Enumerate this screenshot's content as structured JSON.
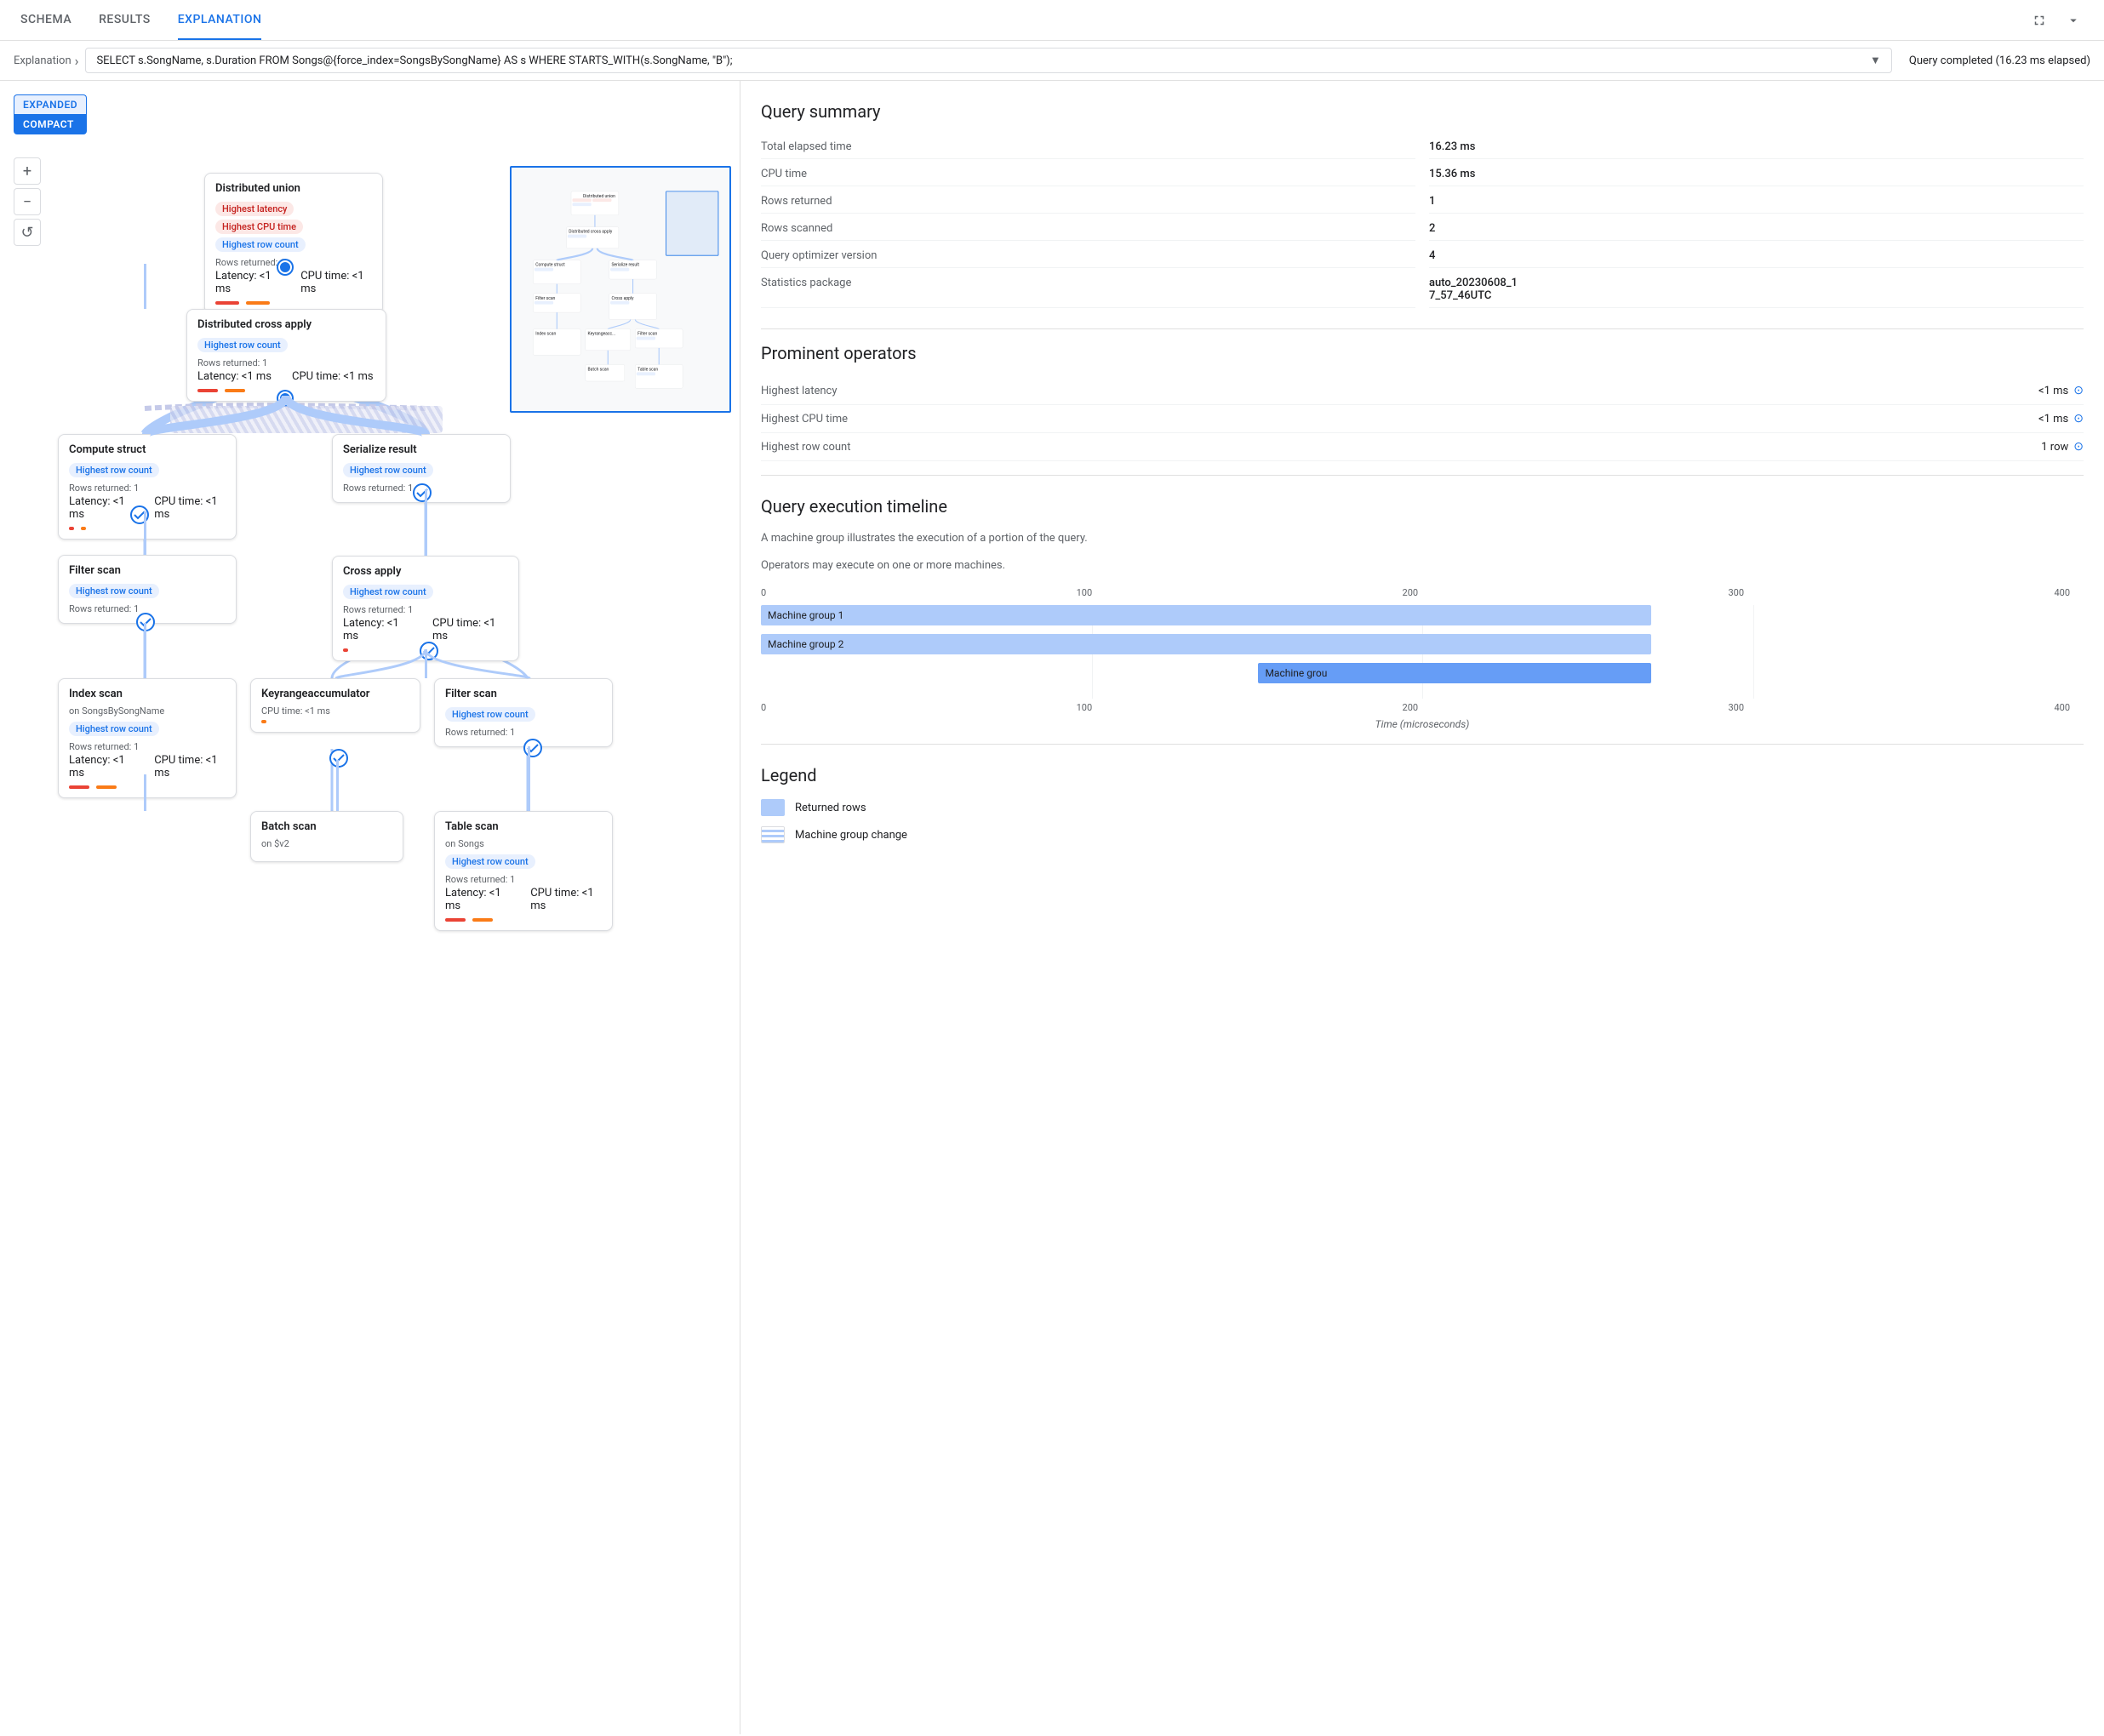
{
  "tabs": {
    "items": [
      "SCHEMA",
      "RESULTS",
      "EXPLANATION"
    ],
    "active": "EXPLANATION"
  },
  "query_bar": {
    "breadcrumb": "Explanation",
    "query_text": "SELECT s.SongName, s.Duration FROM Songs@{force_index=SongsBySongName} AS s WHERE STARTS_WITH(s.SongName, \"B\");",
    "status": "Query completed (16.23 ms elapsed)"
  },
  "view_toggle": {
    "expanded_label": "EXPANDED",
    "compact_label": "COMPACT"
  },
  "zoom": {
    "plus": "+",
    "minus": "−",
    "reset": "↺"
  },
  "nodes": [
    {
      "id": "distributed-union",
      "title": "Distributed union",
      "badges": [
        "Highest latency",
        "Highest CPU time",
        "Highest row count"
      ],
      "badge_types": [
        "red",
        "red",
        "blue"
      ],
      "rows_returned": "Rows returned: 1",
      "latency": "Latency: <1 ms",
      "cpu_time": "CPU time: <1 ms"
    },
    {
      "id": "distributed-cross-apply",
      "title": "Distributed cross apply",
      "badges": [
        "Highest row count"
      ],
      "badge_types": [
        "blue"
      ],
      "rows_returned": "Rows returned: 1",
      "latency": "Latency: <1 ms",
      "cpu_time": "CPU time: <1 ms"
    },
    {
      "id": "compute-struct",
      "title": "Compute struct",
      "badges": [
        "Highest row count"
      ],
      "badge_types": [
        "blue"
      ],
      "rows_returned": "Rows returned: 1",
      "latency": "Latency: <1 ms",
      "cpu_time": "CPU time: <1 ms"
    },
    {
      "id": "serialize-result",
      "title": "Serialize result",
      "badges": [
        "Highest row count"
      ],
      "badge_types": [
        "blue"
      ],
      "rows_returned": "Rows returned: 1"
    },
    {
      "id": "filter-scan-1",
      "title": "Filter scan",
      "badges": [
        "Highest row count"
      ],
      "badge_types": [
        "blue"
      ],
      "rows_returned": "Rows returned: 1"
    },
    {
      "id": "cross-apply",
      "title": "Cross apply",
      "badges": [
        "Highest row count"
      ],
      "badge_types": [
        "blue"
      ],
      "rows_returned": "Rows returned: 1",
      "latency": "Latency: <1 ms",
      "cpu_time": "CPU time: <1 ms"
    },
    {
      "id": "index-scan",
      "title": "Index scan",
      "subtitle": "on SongsBySongName",
      "badges": [
        "Highest row count"
      ],
      "badge_types": [
        "blue"
      ],
      "rows_returned": "Rows returned: 1",
      "latency": "Latency: <1 ms",
      "cpu_time": "CPU time: <1 ms"
    },
    {
      "id": "keyrangeaccumulator",
      "title": "Keyrangeaccumulator",
      "cpu_time": "CPU time: <1 ms"
    },
    {
      "id": "filter-scan-2",
      "title": "Filter scan",
      "badges": [
        "Highest row count"
      ],
      "badge_types": [
        "blue"
      ],
      "rows_returned": "Rows returned: 1"
    },
    {
      "id": "batch-scan",
      "title": "Batch scan",
      "subtitle": "on $v2"
    },
    {
      "id": "table-scan",
      "title": "Table scan",
      "subtitle": "on Songs",
      "badges": [
        "Highest row count"
      ],
      "badge_types": [
        "blue"
      ],
      "rows_returned": "Rows returned: 1",
      "latency": "Latency: <1 ms",
      "cpu_time": "CPU time: <1 ms"
    }
  ],
  "query_summary": {
    "title": "Query summary",
    "stats": [
      {
        "label": "Total elapsed time",
        "value": "16.23 ms"
      },
      {
        "label": "CPU time",
        "value": "15.36 ms"
      },
      {
        "label": "Rows returned",
        "value": "1"
      },
      {
        "label": "Rows scanned",
        "value": "2"
      },
      {
        "label": "Query optimizer version",
        "value": "4"
      },
      {
        "label": "Statistics package",
        "value": "auto_20230608_17_57_46UTC"
      }
    ]
  },
  "prominent_operators": {
    "title": "Prominent operators",
    "items": [
      {
        "label": "Highest latency",
        "value": "<1 ms"
      },
      {
        "label": "Highest CPU time",
        "value": "<1 ms"
      },
      {
        "label": "Highest row count",
        "value": "1 row"
      }
    ]
  },
  "timeline": {
    "title": "Query execution timeline",
    "description1": "A machine group illustrates the execution of a portion of the query.",
    "description2": "Operators may execute on one or more machines.",
    "axis_labels": [
      "0",
      "100",
      "200",
      "300",
      "400"
    ],
    "bars": [
      {
        "label": "Machine group 1",
        "width_pct": 68,
        "left_pct": 0
      },
      {
        "label": "Machine group 2",
        "width_pct": 68,
        "left_pct": 0
      },
      {
        "label": "Machine grou",
        "width_pct": 30,
        "left_pct": 38
      }
    ],
    "x_label": "Time (microseconds)"
  },
  "legend": {
    "title": "Legend",
    "items": [
      {
        "type": "rows",
        "label": "Returned rows"
      },
      {
        "type": "machine",
        "label": "Machine group change"
      }
    ]
  }
}
